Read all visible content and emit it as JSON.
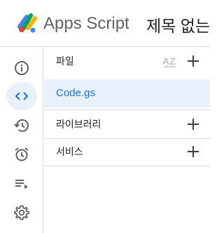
{
  "header": {
    "app_name": "Apps Script",
    "project_name": "제목 없는"
  },
  "rail": {
    "items": [
      {
        "icon": "info-icon",
        "active": false
      },
      {
        "icon": "code-icon",
        "active": true
      },
      {
        "icon": "history-icon",
        "active": false
      },
      {
        "icon": "alarm-icon",
        "active": false
      },
      {
        "icon": "executions-icon",
        "active": false
      },
      {
        "icon": "gear-icon",
        "active": false
      }
    ]
  },
  "panel": {
    "files_label": "파일",
    "sort_icon_text": "AZ",
    "files": [
      {
        "name": "Code.gs",
        "selected": true
      }
    ],
    "libraries_label": "라이브러리",
    "services_label": "서비스"
  },
  "colors": {
    "accent": "#1a73e8",
    "selected_bg": "#e8f0fe",
    "icon": "#5f6368",
    "divider": "#dadce0"
  }
}
